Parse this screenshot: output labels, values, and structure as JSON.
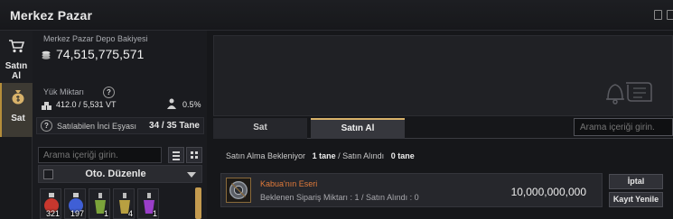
{
  "window": {
    "title": "Merkez Pazar"
  },
  "left_tabs": [
    {
      "label": "Satın Al",
      "icon": "cart-icon"
    },
    {
      "label": "Sat",
      "icon": "money-bag-icon"
    }
  ],
  "balance": {
    "label": "Merkez Pazar Depo Bakiyesi",
    "value": "74,515,775,571",
    "icon": "silver-coin-stack-icon"
  },
  "weight": {
    "label": "Yük Miktarı",
    "value": "412.0 / 5,531 VT",
    "percent": "0.5%"
  },
  "slots": {
    "label": "Satılabilen İnci Eşyası",
    "value": "34 / 35 Tane"
  },
  "left_search": {
    "placeholder": "Arama içeriği girin."
  },
  "sort": {
    "label": "Oto. Düzenle"
  },
  "inventory": [
    {
      "count": "321",
      "color": "#c8372e"
    },
    {
      "count": "197",
      "color": "#3f5fd6"
    },
    {
      "count": "1",
      "color": "#7ba33a"
    },
    {
      "count": "4",
      "color": "#b8a041"
    },
    {
      "count": "1",
      "color": "#9a3ec9"
    }
  ],
  "main_tabs": [
    {
      "label": "Sat",
      "active": false
    },
    {
      "label": "Satın Al",
      "active": true
    }
  ],
  "right_search": {
    "placeholder": "Arama içeriği girin."
  },
  "pending": {
    "label": "Satın Alma Bekleniyor",
    "pending_value": "1 tane",
    "separator": "/",
    "received_label": "Satın Alındı",
    "received_value": "0 tane"
  },
  "order": {
    "name": "Kabua'nın Eseri",
    "sub": "Beklenen Sipariş Miktarı : 1 / Satın Alındı : 0",
    "price": "10,000,000,000",
    "name_color": "#e07a3a"
  },
  "actions": {
    "cancel": "İptal",
    "renew": "Kayıt Yenile"
  },
  "accent_color": "#c49b4f"
}
